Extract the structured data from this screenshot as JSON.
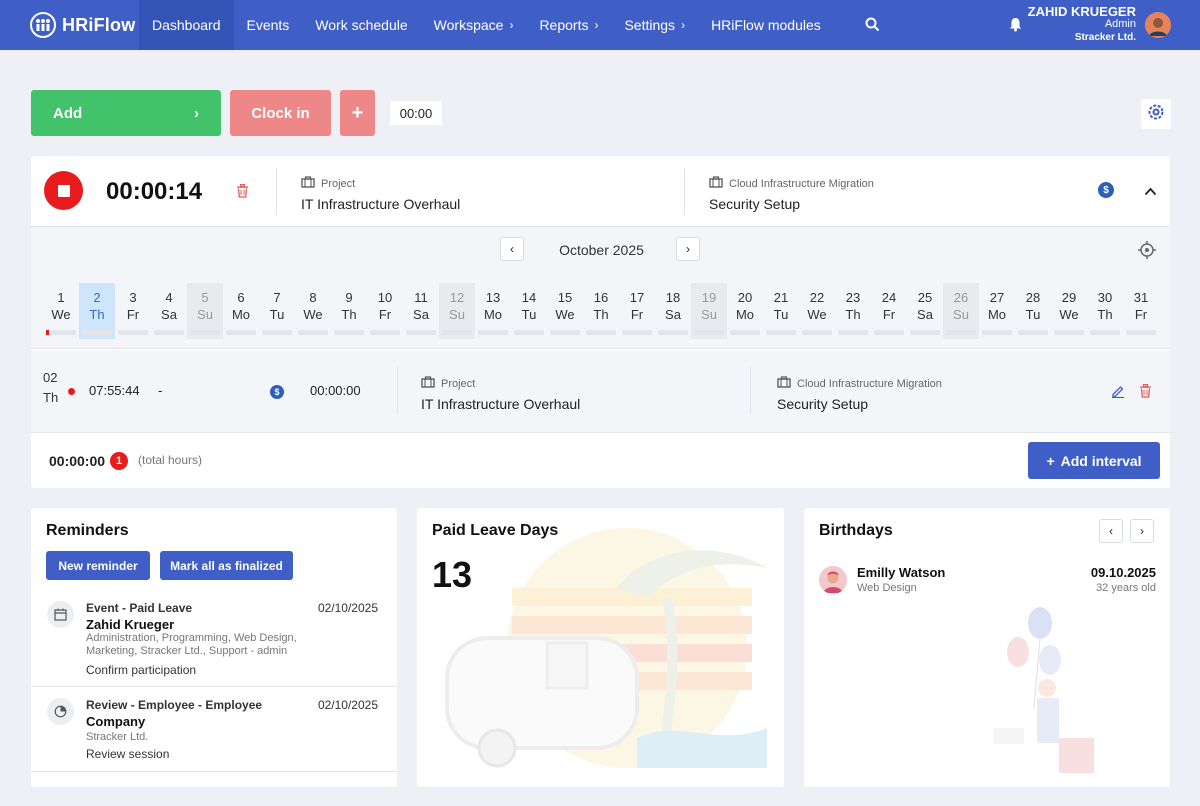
{
  "app": {
    "logo_text": "HRiFlow"
  },
  "nav": {
    "items": [
      {
        "label": "Dashboard",
        "active": true
      },
      {
        "label": "Events"
      },
      {
        "label": "Work schedule"
      },
      {
        "label": "Workspace",
        "has_submenu": true
      },
      {
        "label": "Reports",
        "has_submenu": true
      },
      {
        "label": "Settings",
        "has_submenu": true
      },
      {
        "label": "HRiFlow modules"
      }
    ]
  },
  "user": {
    "name": "ZAHID KRUEGER",
    "role": "Admin",
    "company": "Stracker Ltd."
  },
  "toolbar": {
    "add_label": "Add",
    "clock_in_label": "Clock in",
    "plus_label": "+",
    "time_chip": "00:00"
  },
  "timer": {
    "value": "00:00:14",
    "project_label": "Project",
    "project_value": "IT Infrastructure Overhaul",
    "task_label": "Cloud Infrastructure Migration",
    "task_value": "Security Setup"
  },
  "calendar": {
    "month": "October 2025",
    "days": [
      {
        "n": "1",
        "d": "We",
        "mark": true
      },
      {
        "n": "2",
        "d": "Th",
        "today": true
      },
      {
        "n": "3",
        "d": "Fr"
      },
      {
        "n": "4",
        "d": "Sa"
      },
      {
        "n": "5",
        "d": "Su",
        "weekend": true
      },
      {
        "n": "6",
        "d": "Mo"
      },
      {
        "n": "7",
        "d": "Tu"
      },
      {
        "n": "8",
        "d": "We"
      },
      {
        "n": "9",
        "d": "Th"
      },
      {
        "n": "10",
        "d": "Fr"
      },
      {
        "n": "11",
        "d": "Sa"
      },
      {
        "n": "12",
        "d": "Su",
        "weekend": true
      },
      {
        "n": "13",
        "d": "Mo"
      },
      {
        "n": "14",
        "d": "Tu"
      },
      {
        "n": "15",
        "d": "We"
      },
      {
        "n": "16",
        "d": "Th"
      },
      {
        "n": "17",
        "d": "Fr"
      },
      {
        "n": "18",
        "d": "Sa"
      },
      {
        "n": "19",
        "d": "Su",
        "weekend": true
      },
      {
        "n": "20",
        "d": "Mo"
      },
      {
        "n": "21",
        "d": "Tu"
      },
      {
        "n": "22",
        "d": "We"
      },
      {
        "n": "23",
        "d": "Th"
      },
      {
        "n": "24",
        "d": "Fr"
      },
      {
        "n": "25",
        "d": "Sa"
      },
      {
        "n": "26",
        "d": "Su",
        "weekend": true
      },
      {
        "n": "27",
        "d": "Mo"
      },
      {
        "n": "28",
        "d": "Tu"
      },
      {
        "n": "29",
        "d": "We"
      },
      {
        "n": "30",
        "d": "Th"
      },
      {
        "n": "31",
        "d": "Fr"
      }
    ]
  },
  "entry": {
    "day_num": "02",
    "day_name": "Th",
    "start": "07:55:44",
    "end": "-",
    "duration": "00:00:00",
    "project_label": "Project",
    "project_value": "IT Infrastructure Overhaul",
    "task_label": "Cloud Infrastructure Migration",
    "task_value": "Security Setup"
  },
  "summary": {
    "total": "00:00:00",
    "count": "1",
    "total_label": "(total hours)",
    "add_interval_label": "Add interval"
  },
  "reminders": {
    "title": "Reminders",
    "new_btn": "New reminder",
    "mark_btn": "Mark all as finalized",
    "items": [
      {
        "type": "Event - Paid Leave",
        "date": "02/10/2025",
        "name": "Zahid Krueger",
        "sub": "Administration, Programming, Web Design, Marketing, Stracker Ltd., Support - admin",
        "action": "Confirm participation"
      },
      {
        "type": "Review - Employee - Employee",
        "date": "02/10/2025",
        "name": "Company",
        "sub": "Stracker Ltd.",
        "action": "Review session"
      }
    ]
  },
  "leave": {
    "title": "Paid Leave Days",
    "value": "13"
  },
  "birthdays": {
    "title": "Birthdays",
    "name": "Emilly Watson",
    "dept": "Web Design",
    "date": "09.10.2025",
    "age": "32 years old"
  },
  "colors": {
    "brand": "#3f5fc6",
    "add_green": "#42c26a",
    "clock_red": "#ee8787",
    "stop_red": "#e81c1c",
    "today_bg": "#cfe5fb"
  }
}
